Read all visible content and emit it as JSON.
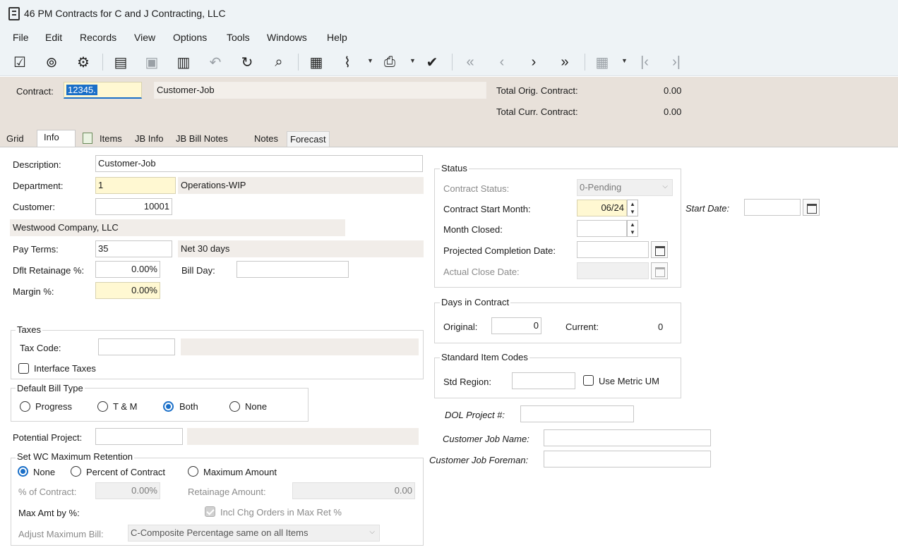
{
  "window": {
    "title": "46 PM Contracts for C and J Contracting, LLC"
  },
  "menu": [
    "File",
    "Edit",
    "Records",
    "View",
    "Options",
    "Tools",
    "Windows",
    "Help"
  ],
  "header": {
    "contract_label": "Contract:",
    "contract_value": "12345.",
    "contract_desc": "Customer-Job",
    "total_orig_label": "Total Orig. Contract:",
    "total_orig_value": "0.00",
    "total_curr_label": "Total Curr. Contract:",
    "total_curr_value": "0.00"
  },
  "tabs": [
    "Grid",
    "Info",
    "Items",
    "JB Info",
    "JB Bill Notes",
    "Notes",
    "Forecast"
  ],
  "info": {
    "description_label": "Description:",
    "description_value": "Customer-Job",
    "department_label": "Department:",
    "department_value": "1",
    "department_desc": "Operations-WIP",
    "customer_label": "Customer:",
    "customer_value": "10001",
    "customer_name": "Westwood Company, LLC",
    "pay_terms_label": "Pay Terms:",
    "pay_terms_value": "35",
    "pay_terms_desc": "Net 30 days",
    "retainage_label": "Dflt Retainage %:",
    "retainage_value": "0.00%",
    "bill_day_label": "Bill Day:",
    "margin_label": "Margin %:",
    "margin_value": "0.00%"
  },
  "taxes": {
    "title": "Taxes",
    "tax_code_label": "Tax Code:",
    "interface_label": "Interface Taxes"
  },
  "bill_type": {
    "title": "Default Bill Type",
    "options": [
      "Progress",
      "T & M",
      "Both",
      "None"
    ],
    "selected": "Both"
  },
  "potential_project_label": "Potential Project:",
  "wc_retention": {
    "title": "Set WC Maximum Retention",
    "options": [
      "None",
      "Percent of Contract",
      "Maximum Amount"
    ],
    "selected": "None",
    "pct_contract_label": "% of Contract:",
    "pct_contract_value": "0.00%",
    "retainage_amount_label": "Retainage Amount:",
    "retainage_amount_value": "0.00",
    "max_amt_label": "Max Amt by %:",
    "incl_chg_label": "Incl Chg Orders in Max Ret %",
    "adjust_label": "Adjust Maximum Bill:",
    "adjust_value": "C-Composite Percentage same on all Items"
  },
  "status": {
    "title": "Status",
    "contract_status_label": "Contract Status:",
    "contract_status_value": "0-Pending",
    "start_month_label": "Contract Start Month:",
    "start_month_value": "06/24",
    "month_closed_label": "Month Closed:",
    "projected_label": "Projected Completion Date:",
    "actual_close_label": "Actual Close Date:",
    "start_date_label": "Start Date:"
  },
  "days": {
    "title": "Days in Contract",
    "original_label": "Original:",
    "original_value": "0",
    "current_label": "Current:",
    "current_value": "0"
  },
  "std_item": {
    "title": "Standard Item Codes",
    "region_label": "Std Region:",
    "metric_label": "Use Metric UM"
  },
  "dol_label": "DOL Project #:",
  "cust_job_name_label": "Customer Job Name:",
  "cust_job_foreman_label": "Customer Job Foreman:"
}
